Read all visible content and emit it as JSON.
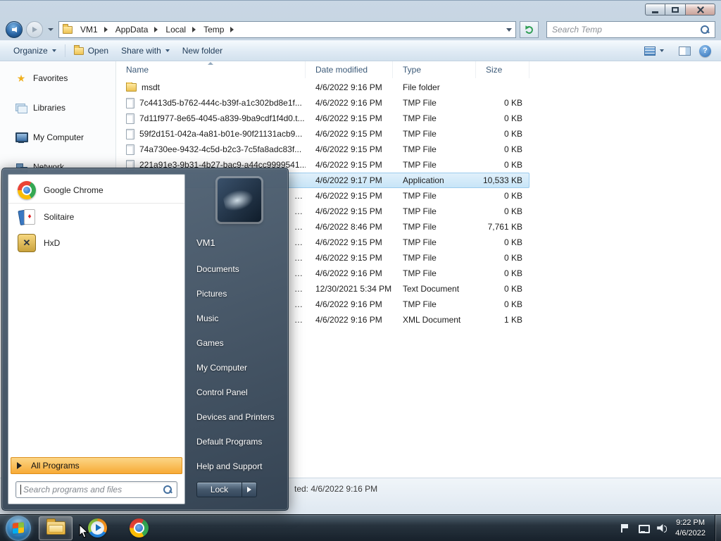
{
  "window": {
    "status_fragment": "ted: 4/6/2022 9:16 PM"
  },
  "address": {
    "breadcrumb": [
      "VM1",
      "AppData",
      "Local",
      "Temp"
    ],
    "search_placeholder": "Search Temp"
  },
  "toolbar": {
    "organize_label": "Organize",
    "open_label": "Open",
    "share_label": "Share with",
    "new_folder_label": "New folder"
  },
  "sidebar": {
    "items": [
      {
        "label": "Favorites",
        "icon": "star"
      },
      {
        "label": "Libraries",
        "icon": "libraries"
      },
      {
        "label": "My Computer",
        "icon": "computer"
      },
      {
        "label": "Network",
        "icon": "network"
      }
    ]
  },
  "file_list": {
    "columns": [
      "Name",
      "Date modified",
      "Type",
      "Size"
    ],
    "rows": [
      {
        "name": "msdt",
        "date": "4/6/2022 9:16 PM",
        "type": "File folder",
        "size": "",
        "icon": "folder"
      },
      {
        "name": "7c4413d5-b762-444c-b39f-a1c302bd8e1f...",
        "date": "4/6/2022 9:16 PM",
        "type": "TMP File",
        "size": "0 KB",
        "icon": "file"
      },
      {
        "name": "7d11f977-8e65-4045-a839-9ba9cdf1f4d0.t...",
        "date": "4/6/2022 9:15 PM",
        "type": "TMP File",
        "size": "0 KB",
        "icon": "file"
      },
      {
        "name": "59f2d151-042a-4a81-b01e-90f21131acb9...",
        "date": "4/6/2022 9:15 PM",
        "type": "TMP File",
        "size": "0 KB",
        "icon": "file"
      },
      {
        "name": "74a730ee-9432-4c5d-b2c3-7c5fa8adc83f...",
        "date": "4/6/2022 9:15 PM",
        "type": "TMP File",
        "size": "0 KB",
        "icon": "file"
      },
      {
        "name": "221a91e3-9b31-4b27-bac9-a44cc9999541...",
        "date": "4/6/2022 9:15 PM",
        "type": "TMP File",
        "size": "0 KB",
        "icon": "file"
      },
      {
        "name": "",
        "date": "4/6/2022 9:17 PM",
        "type": "Application",
        "size": "10,533 KB",
        "selected": true
      },
      {
        "name": "…",
        "date": "4/6/2022 9:15 PM",
        "type": "TMP File",
        "size": "0 KB",
        "frag": true
      },
      {
        "name": "…",
        "date": "4/6/2022 9:15 PM",
        "type": "TMP File",
        "size": "0 KB",
        "frag": true
      },
      {
        "name": "…",
        "date": "4/6/2022 8:46 PM",
        "type": "TMP File",
        "size": "7,761 KB",
        "frag": true
      },
      {
        "name": "…",
        "date": "4/6/2022 9:15 PM",
        "type": "TMP File",
        "size": "0 KB",
        "frag": true
      },
      {
        "name": "…",
        "date": "4/6/2022 9:15 PM",
        "type": "TMP File",
        "size": "0 KB",
        "frag": true
      },
      {
        "name": "…",
        "date": "4/6/2022 9:16 PM",
        "type": "TMP File",
        "size": "0 KB",
        "frag": true
      },
      {
        "name": "…",
        "date": "12/30/2021 5:34 PM",
        "type": "Text Document",
        "size": "0 KB",
        "frag": true
      },
      {
        "name": "…",
        "date": "4/6/2022 9:16 PM",
        "type": "TMP File",
        "size": "0 KB",
        "frag": true
      },
      {
        "name": "…",
        "date": "4/6/2022 9:16 PM",
        "type": "XML Document",
        "size": "1 KB",
        "frag": true
      }
    ]
  },
  "start_menu": {
    "programs": [
      {
        "label": "Google Chrome",
        "icon": "chrome"
      },
      {
        "label": "Solitaire",
        "icon": "solitaire"
      },
      {
        "label": "HxD",
        "icon": "hxd"
      }
    ],
    "all_programs_label": "All Programs",
    "search_placeholder": "Search programs and files",
    "user_name": "VM1",
    "places": [
      "Documents",
      "Pictures",
      "Music",
      "Games",
      "My Computer",
      "Control Panel",
      "Devices and Printers",
      "Default Programs",
      "Help and Support"
    ],
    "lock_label": "Lock"
  },
  "taskbar": {
    "clock_time": "9:22 PM",
    "clock_date": "4/6/2022"
  },
  "colors": {
    "selection": "#c6e4f7",
    "selection_border": "#9bcbee",
    "highlight_orange": "#f7a832",
    "taskbar_dark": "#17212b"
  }
}
